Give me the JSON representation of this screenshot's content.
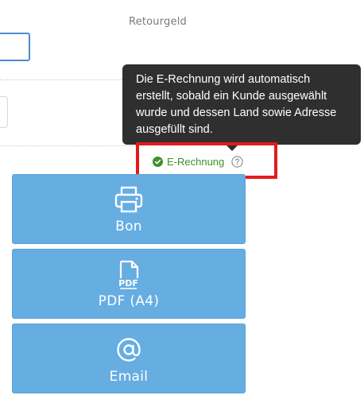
{
  "header": {
    "retour_label": "Retourgeld"
  },
  "tooltip": {
    "text": "Die E-Rechnung wird automatisch erstellt, sobald ein Kunde ausgewählt wurde und dessen Land sowie Adresse ausgefüllt sind."
  },
  "erechnung": {
    "label": "E-Rechnung",
    "status": "enabled",
    "status_color": "#3f8f2b",
    "status_icon": "check-circle-icon",
    "help_icon": "question-circle-icon"
  },
  "actions": [
    {
      "label": "Bon",
      "icon": "printer-icon"
    },
    {
      "label": "PDF (A4)",
      "icon": "pdf-file-icon"
    },
    {
      "label": "Email",
      "icon": "at-sign-icon"
    }
  ],
  "colors": {
    "button_bg": "#66ade2",
    "tooltip_bg": "#2f2f2f",
    "highlight": "#e21b1b",
    "focus_border": "#4a8ed0"
  }
}
